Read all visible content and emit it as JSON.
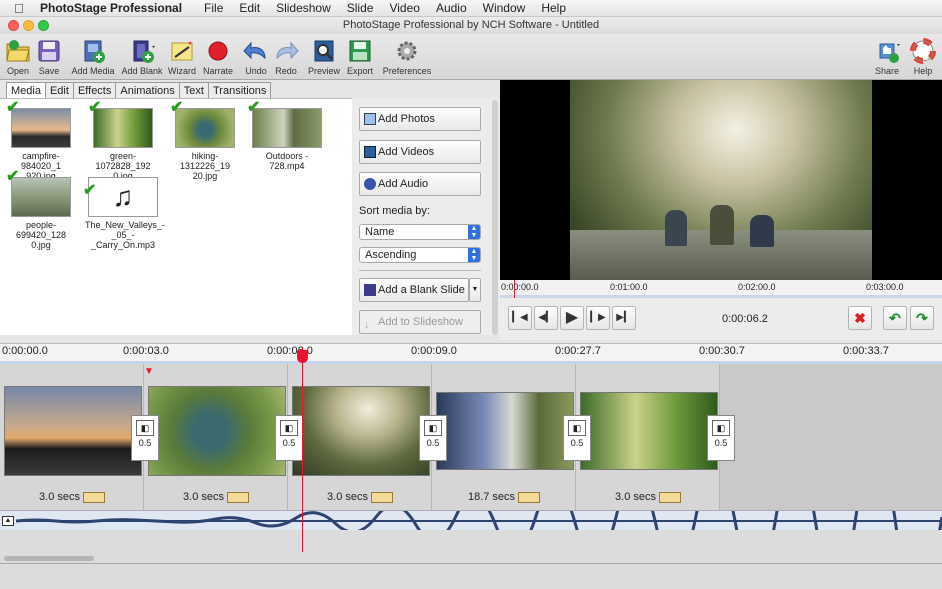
{
  "menubar": {
    "apple": "",
    "app": "PhotoStage Professional",
    "items": [
      "File",
      "Edit",
      "Slideshow",
      "Slide",
      "Video",
      "Audio",
      "Window",
      "Help"
    ]
  },
  "window": {
    "title": "PhotoStage Professional by NCH Software - Untitled"
  },
  "toolbar": {
    "open": "Open",
    "save": "Save",
    "add_media": "Add Media",
    "add_blank": "Add Blank",
    "wizard": "Wizard",
    "narrate": "Narrate",
    "undo": "Undo",
    "redo": "Redo",
    "preview": "Preview",
    "export": "Export",
    "preferences": "Preferences",
    "share": "Share",
    "help": "Help"
  },
  "tabs": [
    "Media",
    "Edit",
    "Effects",
    "Animations",
    "Text",
    "Transitions"
  ],
  "media": [
    {
      "name": "campfire-984020_1920.jpg",
      "l1": "campfire-984020_1",
      "l2": "920.jpg"
    },
    {
      "name": "green-1072828_1920.jpg",
      "l1": "green-1072828_192",
      "l2": "0.jpg"
    },
    {
      "name": "hiking-1312226_1920.jpg",
      "l1": "hiking-1312226_19",
      "l2": "20.jpg"
    },
    {
      "name": "Outdoors-728.mp4",
      "l1": "Outdoors -",
      "l2": "728.mp4"
    },
    {
      "name": "people-699420_1280.jpg",
      "l1": "people-699420_128",
      "l2": "0.jpg"
    },
    {
      "name": "The_New_Valleys_-_05_-_Carry_On.mp3",
      "l1": "The_New_Valleys_-",
      "l2": "_05_-_Carry_On.mp3"
    }
  ],
  "side": {
    "add_photos": "Add Photos",
    "add_videos": "Add Videos",
    "add_audio": "Add Audio",
    "sort_label": "Sort media by:",
    "sort_field": "Name",
    "sort_order": "Ascending",
    "add_blank_slide": "Add a Blank Slide",
    "add_to_slideshow": "Add to Slideshow"
  },
  "preview": {
    "ticks": [
      "0:00:00.0",
      "0:01:00.0",
      "0:02:00.0",
      "0:03:00.0"
    ],
    "time": "0:00:06.2"
  },
  "timeline": {
    "ticks": [
      "0:00:00.0",
      "0:00:03.0",
      "0:00:06.0",
      "0:00:09.0",
      "0:00:27.7",
      "0:00:30.7",
      "0:00:33.7"
    ]
  },
  "slides": [
    {
      "duration": "3.0 secs",
      "transition": "0.5"
    },
    {
      "duration": "3.0 secs",
      "transition": "0.5"
    },
    {
      "duration": "3.0 secs",
      "transition": "0.5"
    },
    {
      "duration": "18.7 secs",
      "transition": "0.5"
    },
    {
      "duration": "3.0 secs",
      "transition": "0.5"
    }
  ],
  "colors": {
    "accent": "#2b72e0",
    "playhead": "#e8132d",
    "check": "#2c9a1e"
  }
}
